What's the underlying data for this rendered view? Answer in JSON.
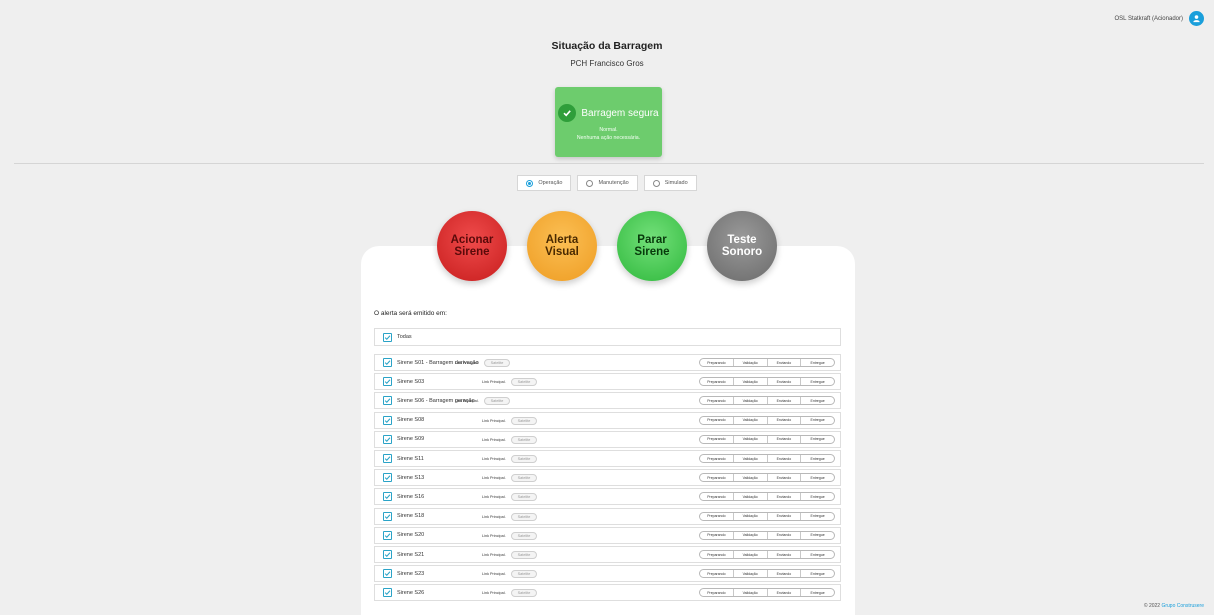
{
  "user": {
    "name": "OSL Statkraft (Acionador)",
    "icon": "user-icon"
  },
  "header": {
    "title": "Situação da Barragem",
    "subtitle": "PCH Francisco Gros"
  },
  "status": {
    "heading": "Barragem segura",
    "line1": "Normal.",
    "line2": "Nenhuma ação necessária.",
    "color": "#6dcc6d",
    "icon": "check-circle-icon"
  },
  "modes": [
    {
      "label": "Operação",
      "selected": true
    },
    {
      "label": "Manutenção",
      "selected": false
    },
    {
      "label": "Simulado",
      "selected": false
    }
  ],
  "actions": {
    "trigger": {
      "line1": "Acionar",
      "line2": "Sirene",
      "color": "#d62d2d"
    },
    "visual": {
      "line1": "Alerta",
      "line2": "Visual",
      "color": "#f2a93a"
    },
    "stop": {
      "line1": "Parar",
      "line2": "Sirene",
      "color": "#47c551"
    },
    "test": {
      "line1": "Teste",
      "line2": "Sonoro",
      "color": "#808080"
    }
  },
  "alert_label": "O alerta será emitido em:",
  "all_label": "Todas",
  "link_labels": {
    "main": "Link Principal.",
    "satellite": "Satelite"
  },
  "steps": [
    "Preparando",
    "Validação",
    "Enviando",
    "Entregue"
  ],
  "sirens": [
    {
      "name": "Sirene S01 - Barragem derivação",
      "checked": true
    },
    {
      "name": "Sirene S03",
      "checked": true
    },
    {
      "name": "Sirene S06 - Barragem geração",
      "checked": true
    },
    {
      "name": "Sirene S08",
      "checked": true
    },
    {
      "name": "Sirene S09",
      "checked": true
    },
    {
      "name": "Sirene S11",
      "checked": true
    },
    {
      "name": "Sirene S13",
      "checked": true
    },
    {
      "name": "Sirene S16",
      "checked": true
    },
    {
      "name": "Sirene S18",
      "checked": true
    },
    {
      "name": "Sirene S20",
      "checked": true
    },
    {
      "name": "Sirene S21",
      "checked": true
    },
    {
      "name": "Sirene S23",
      "checked": true
    },
    {
      "name": "Sirene S26",
      "checked": true
    }
  ],
  "footer": {
    "copyright": "© 2022",
    "brand": "Grupo Construsere"
  }
}
